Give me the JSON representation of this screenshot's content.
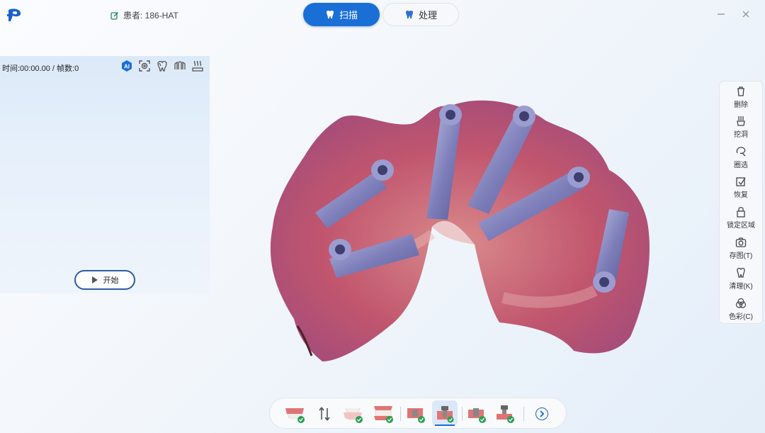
{
  "header": {
    "patient": "患者: 186-HAT",
    "tabs": [
      {
        "label": "扫描",
        "active": true
      },
      {
        "label": "处理",
        "active": false
      }
    ]
  },
  "scan_panel": {
    "time_info": "时间:00:00.00 / 帧数:0",
    "tools": [
      "ai-icon",
      "focus-icon",
      "tooth-scan-icon",
      "arch-icon",
      "heat-icon"
    ],
    "start_label": "开始"
  },
  "side_tools": [
    {
      "label": "删除",
      "icon": "trash-icon"
    },
    {
      "label": "挖洞",
      "icon": "dig-hole-icon"
    },
    {
      "label": "圈选",
      "icon": "lasso-icon"
    },
    {
      "label": "恢复",
      "icon": "restore-icon"
    },
    {
      "label": "锁定区域",
      "icon": "lock-icon"
    },
    {
      "label": "存图(T)",
      "icon": "camera-icon"
    },
    {
      "label": "清理(K)",
      "icon": "clean-icon"
    },
    {
      "label": "色彩(C)",
      "icon": "color-icon"
    }
  ],
  "bottom_tools": [
    "upper-jaw-icon",
    "swap-icon",
    "lower-jaw-icon",
    "bite-icon",
    "scanbody-upper-icon",
    "scanbody-active-icon",
    "scanbody-lower-icon",
    "scanbody-bite-icon"
  ],
  "colors": {
    "accent": "#1a6fd6",
    "panel": "#e3eefa",
    "tissue": "#c0506a"
  }
}
